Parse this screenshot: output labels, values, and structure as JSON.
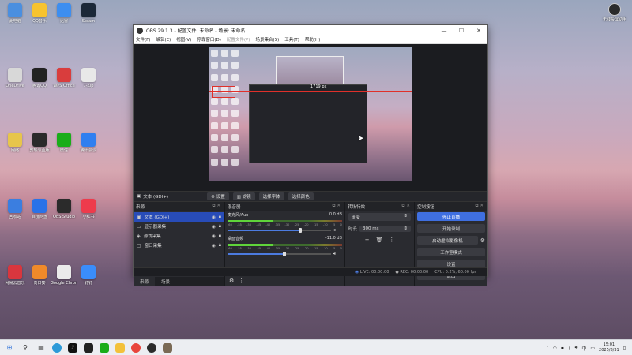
{
  "desktop": {
    "icons": [
      {
        "label": "此电脑",
        "color": "#4a8fe0"
      },
      {
        "label": "OneDrive",
        "color": "#d8d8d8"
      },
      {
        "label": "网络",
        "color": "#e7c54b"
      },
      {
        "label": "回收站",
        "color": "#3b7ee0"
      },
      {
        "label": "网易云音乐",
        "color": "#d9363e"
      },
      {
        "label": "QQ音乐",
        "color": "#f7c32f"
      },
      {
        "label": "腾讯QQ",
        "color": "#222222"
      },
      {
        "label": "剪映专业版",
        "color": "#2a2a2a"
      },
      {
        "label": "百度网盘",
        "color": "#2a72e8"
      },
      {
        "label": "向日葵",
        "color": "#f08a2a"
      },
      {
        "label": "迅雷",
        "color": "#3d8ef0"
      },
      {
        "label": "WPS Office",
        "color": "#d93d3d"
      },
      {
        "label": "微信",
        "color": "#1aad19"
      },
      {
        "label": "OBS Studio",
        "color": "#2b2b2b"
      },
      {
        "label": "Google Chrome",
        "color": "#eaeaea"
      },
      {
        "label": "Steam",
        "color": "#1b2838"
      },
      {
        "label": "7-Zip",
        "color": "#e8e8e8"
      },
      {
        "label": "腾讯会议",
        "color": "#2f7ff0"
      },
      {
        "label": "小红书",
        "color": "#ee3b4c"
      },
      {
        "label": "钉钉",
        "color": "#3a8dfa"
      }
    ],
    "corner_icon": {
      "label": "无线投屏助手"
    }
  },
  "obs": {
    "window_title": "OBS 29.1.3 - 配置文件: 未命名 - 场景: 未命名",
    "window_buttons": [
      "—",
      "☐",
      "✕"
    ],
    "menu": [
      "文件(F)",
      "编辑(E)",
      "视图(V)",
      "停靠窗口(D)",
      "配置文件(P)",
      "场景集合(S)",
      "工具(T)",
      "帮助(H)"
    ],
    "preview": {
      "measure_label": "1719 px"
    },
    "source_bar": {
      "source_name": "文本 (GDI+)",
      "buttons": [
        "设置",
        "滤镜",
        "选择字体",
        "选择颜色"
      ]
    },
    "sources_dock": {
      "title": "来源",
      "items": [
        {
          "name": "文本 (GDI+)",
          "selected": true
        },
        {
          "name": "显示器采集",
          "selected": false
        },
        {
          "name": "游戏采集",
          "selected": false
        },
        {
          "name": "窗口采集",
          "selected": false
        }
      ],
      "tabs": [
        "来源",
        "场景"
      ]
    },
    "mixer_dock": {
      "title": "混音器",
      "channels": [
        {
          "name": "麦克风/Aux",
          "db": "0.0 dB",
          "level": 0.7
        },
        {
          "name": "桌面音频",
          "db": "-11.0 dB",
          "level": 0.55
        }
      ],
      "ticks": [
        "-60",
        "-55",
        "-50",
        "-45",
        "-40",
        "-35",
        "-30",
        "-25",
        "-20",
        "-15",
        "-10",
        "-5",
        "0"
      ]
    },
    "transitions_dock": {
      "title": "转场特效",
      "transition": "渐变",
      "duration_label": "时长",
      "duration_value": "300 ms"
    },
    "controls_dock": {
      "title": "控制按钮",
      "buttons": [
        "停止直播",
        "开始录制",
        "启动虚拟摄像机",
        "工作室模式",
        "设置",
        "退出"
      ]
    },
    "status": {
      "live": "LIVE: 00:00:00",
      "rec": "REC: 00:00:00",
      "cpu": "CPU: 0.2%, 60.00 fps"
    }
  },
  "taskbar": {
    "clock_time": "15:01",
    "clock_date": "2025/8/31",
    "lang": "中"
  }
}
